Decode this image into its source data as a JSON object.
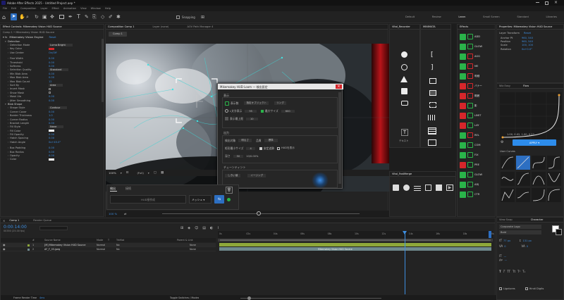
{
  "titlebar": {
    "app_title": "Adobe After Effects 2025 - Untitled Project.aep *",
    "menus": [
      "File",
      "Edit",
      "Composition",
      "Layer",
      "Effect",
      "Animation",
      "View",
      "Window",
      "Help"
    ]
  },
  "toolbar": {
    "snapping_label": "Snapping",
    "workspaces": [
      "Default",
      "Review",
      "Learn",
      "Small Screen",
      "Standard",
      "Libraries"
    ]
  },
  "effect_controls": {
    "tab_title": "Effect Controls: Mikemakey Vision HUD Source",
    "layer_path": "Comp 1 • Mikemakey Vision HUD Source",
    "effect_name": "Mikemakey Vision Engine",
    "reset_label": "Reset",
    "params": [
      {
        "label": "Detection",
        "value": ""
      },
      {
        "label": "Detection Mode",
        "value": "Luma Bright"
      },
      {
        "label": "Key Color",
        "value": ""
      },
      {
        "label": "Use Center",
        "value": "On/Off"
      },
      {
        "label": "",
        "value": ""
      },
      {
        "label": "Fine Width",
        "value": "0.00"
      },
      {
        "label": "Threshold",
        "value": "0.00"
      },
      {
        "label": "Softness",
        "value": "0.00"
      },
      {
        "label": "Selection Quality",
        "value": "Standard"
      },
      {
        "label": "Min Blob Area",
        "value": "0.00"
      },
      {
        "label": "Max Blob Area",
        "value": "0.00"
      },
      {
        "label": "Max Blob Count",
        "value": "12"
      },
      {
        "label": "Sort By",
        "value": "Area"
      },
      {
        "label": "Invert Mask",
        "value": ""
      },
      {
        "label": "Show Mask",
        "value": ""
      },
      {
        "label": "Mask Via",
        "value": "0.00"
      },
      {
        "label": "Jitter Smoothing",
        "value": "0.00"
      },
      {
        "label": "Blob Shape",
        "value": ""
      },
      {
        "label": "Shape Style",
        "value": "Contour"
      },
      {
        "label": "Corner Cover",
        "value": "0.00"
      },
      {
        "label": "Border Thickness",
        "value": "1.0"
      },
      {
        "label": "Corner Radius",
        "value": "0.00"
      },
      {
        "label": "Bracket Length",
        "value": "0.00"
      },
      {
        "label": "Fill Style",
        "value": "None"
      },
      {
        "label": "Fill Color",
        "value": ""
      },
      {
        "label": "Fill Opacity",
        "value": "0.00"
      },
      {
        "label": "Hatch Spacing",
        "value": "0.00"
      },
      {
        "label": "Hatch Angle",
        "value": "0x+45.0°"
      },
      {
        "label": "",
        "value": ""
      },
      {
        "label": "Box Padding",
        "value": "0.00"
      },
      {
        "label": "Box Radius",
        "value": "0.00"
      },
      {
        "label": "Opacity",
        "value": "0.00"
      },
      {
        "label": "Color",
        "value": ""
      }
    ]
  },
  "composition": {
    "tabs": [
      "Composition Comp 1",
      "Layer (none)",
      "AOV Path Manager 4"
    ],
    "comp_chip": "Comp 1",
    "zoom_label": "100%",
    "resolution_label": "(Full)",
    "footer_zoom": "100 %"
  },
  "dialog": {
    "title": "Mikemakey HUD Loom — 検出設定",
    "section_display": "表示",
    "display_toggle": "表示数",
    "display_dropdown": "指定オブジェクト",
    "display_dropdown2": "リング",
    "l_size_label": "L文字表示",
    "l_size_value": "95",
    "max_size_label": "最大サイズ",
    "max_size_value": "600",
    "max_label": "表示最上限",
    "max_value": "10",
    "section_output": "出力",
    "detect_target_label": "検出対象",
    "detect_target_value": "明るさ",
    "quality_label": "品質",
    "quality_value": "標準",
    "rect_min_label": "矩形最小サイズ",
    "rect_min_value": "4",
    "checkbox1": "安定追跡",
    "checkbox2": "HUDを表示",
    "depth_label": "深さ",
    "depth_value": "50",
    "depth_extra": "10/0.00%",
    "section_tint": "チェーンティント",
    "tint_dropdown": "しきい値",
    "tint_dropdown2": "イージング"
  },
  "hud_panel": {
    "tabs": [
      "検出",
      "接続"
    ],
    "hud_button": "HUD接作成",
    "mesh_dropdown": "メッシュ"
  },
  "tools_panel": {
    "tab1": "Vital_Recorder",
    "tab2": "MINIMATA",
    "text_label": "テキスト"
  },
  "small_panel": {
    "tab": "Vital_FastMerge"
  },
  "effect_icons": {
    "tab": "Effects",
    "labels": [
      "ADD",
      "GLOW",
      "AGG",
      "ME",
      "明細",
      "バナー",
      "範囲",
      "影",
      "LIMIT",
      "LAY",
      "REL",
      "COM",
      "FIX",
      "PRE",
      "GLOW",
      "ADJ",
      "CTR"
    ]
  },
  "properties": {
    "tab": "Properties: Mikemakey Vision HUD Source",
    "layer_transform": "Layer Transform",
    "reset": "Reset",
    "rows": [
      {
        "label": "Anchor Pt",
        "value": "960, 540"
      },
      {
        "label": "Position",
        "value": "960, 540"
      },
      {
        "label": "Scale",
        "value": "100, 100"
      },
      {
        "label": "Rotation",
        "value": "0x+0.0°"
      }
    ]
  },
  "curves": {
    "tabs": [
      "Wiz Easy",
      "Flow"
    ],
    "bezier_text": "1.00, 0.02, 1.00, 0.22",
    "apply_button": "APPLY ▾",
    "user_curves_label": "User Curves"
  },
  "character": {
    "tabs": [
      "View Snap",
      "Character"
    ],
    "font": "Corporate Logo",
    "style": "Bold",
    "size": "77 px",
    "leading": "131 px",
    "tracking": "0",
    "kerning": "0",
    "ligatures": "Ligatures",
    "hindi": "Hindi Digits"
  },
  "timeline": {
    "tab": "Comp 1",
    "render_tab": "Render Queue",
    "timecode": "0:00:14:00",
    "frame_info": "00350 (25.00 fps)",
    "columns": [
      "#",
      "Source Name",
      "Mode",
      "T",
      "TrkMat",
      "Parent & Link"
    ],
    "layers": [
      {
        "num": "1",
        "name": "[M] Mikemakey Vision HUD Source",
        "mode": "Normal",
        "trk": "No",
        "parent": "None"
      },
      {
        "num": "2",
        "name": "AF_F_03.jpeg",
        "mode": "Normal",
        "trk": "No",
        "parent": "None"
      }
    ],
    "ruler": [
      "0s",
      "02s",
      "04s",
      "06s",
      "08s",
      "10s",
      "12s",
      "14s",
      "16s",
      "18s",
      "20s"
    ],
    "bar_text": "Mikemakey Vision HUD Source",
    "footer": "Frame Render Time",
    "footer_value": "4ms",
    "toggle": "Toggle Switches / Modes"
  },
  "colors": {
    "accent": "#2d8ceb",
    "green": "#2ab34a",
    "red": "#d6262b",
    "timeline_green": "#8ea83a"
  }
}
